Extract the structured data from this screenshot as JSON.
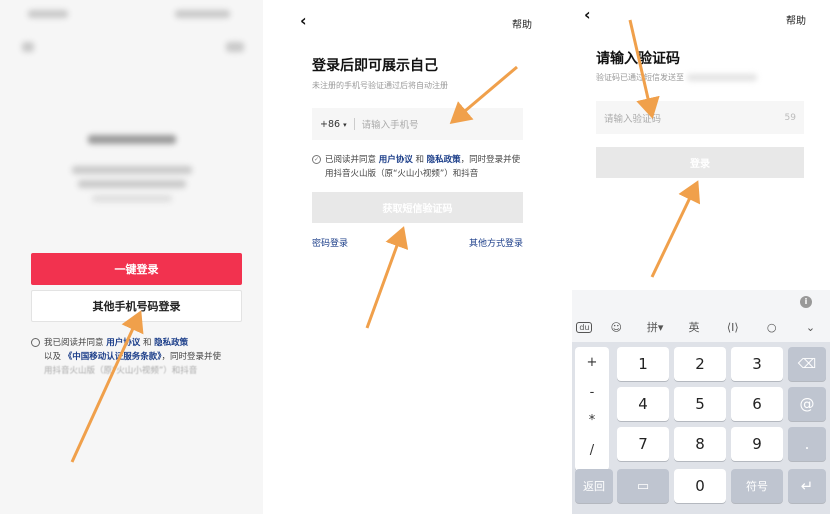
{
  "panel1": {
    "primary_button": "一键登录",
    "secondary_button": "其他手机号码登录",
    "agree_prefix": "我已阅读并同意",
    "link_user_agreement": "用户协议",
    "and": "和",
    "link_privacy": "隐私政策",
    "also": "以及",
    "link_cmcc": "《中国移动认证服务条款》",
    "agree_suffix": "，同时登录并使",
    "agree_faded": "用抖音火山版（原“火山小视频”）和抖音"
  },
  "panel2": {
    "help": "帮助",
    "title": "登录后即可展示自己",
    "subtitle": "未注册的手机号验证通过后将自动注册",
    "country_code": "+86",
    "phone_placeholder": "请输入手机号",
    "agree_prefix": "已阅读并同意",
    "link_user_agreement": "用户协议",
    "and": "和",
    "link_privacy": "隐私政策",
    "agree_suffix": "，同时登录并使用抖音火山版（原“火山小视频”）和抖音",
    "get_code_button": "获取短信验证码",
    "password_login": "密码登录",
    "other_login": "其他方式登录"
  },
  "panel3": {
    "help": "帮助",
    "title": "请输入验证码",
    "subtitle": "验证码已通过短信发送至",
    "code_placeholder": "请输入验证码",
    "countdown": "59",
    "login_button": "登录",
    "keyboard": {
      "toolbar": [
        "du",
        "☺",
        "拼▾",
        "英",
        "⟨I⟩",
        "○",
        "⌄"
      ],
      "left_column": [
        "+",
        "-",
        "*",
        "/"
      ],
      "digits": [
        "1",
        "2",
        "3",
        "4",
        "5",
        "6",
        "7",
        "8",
        "9",
        "0"
      ],
      "at": "@",
      "dot": ".",
      "back_label": "返回",
      "symbol_label": "符号"
    }
  },
  "colors": {
    "brand_red": "#f2324f",
    "link_blue": "#1d3f8a",
    "arrow_orange": "#f0a04b"
  }
}
